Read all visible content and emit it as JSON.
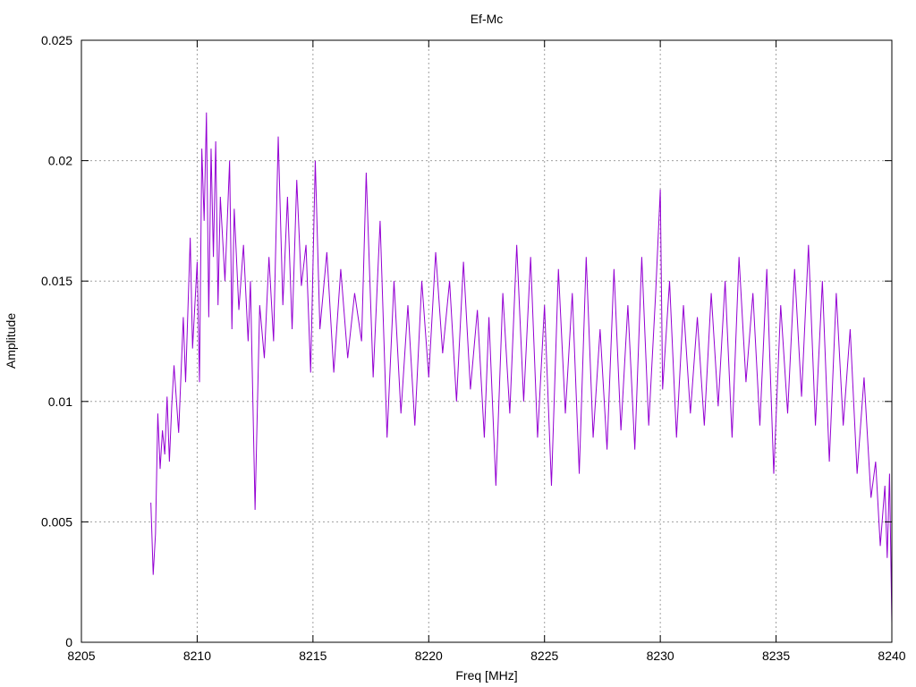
{
  "chart_data": {
    "type": "line",
    "title": "Ef-Mc",
    "xlabel": "Freq [MHz]",
    "ylabel": "Amplitude",
    "xlim": [
      8205,
      8240
    ],
    "ylim": [
      0,
      0.025
    ],
    "x_ticks": [
      8205,
      8210,
      8215,
      8220,
      8225,
      8230,
      8235,
      8240
    ],
    "x_tick_labels": [
      "8205",
      "8210",
      "8215",
      "8220",
      "8225",
      "8230",
      "8235",
      "8240"
    ],
    "y_ticks": [
      0,
      0.005,
      0.01,
      0.015,
      0.02,
      0.025
    ],
    "y_tick_labels": [
      "0",
      "0.005",
      "0.01",
      "0.015",
      "0.02",
      "0.025"
    ],
    "grid": true,
    "series": [
      {
        "color": "#9400d3",
        "x": [
          8208.0,
          8208.1,
          8208.2,
          8208.3,
          8208.4,
          8208.5,
          8208.6,
          8208.7,
          8208.8,
          8208.9,
          8209.0,
          8209.2,
          8209.4,
          8209.5,
          8209.7,
          8209.8,
          8210.0,
          8210.1,
          8210.2,
          8210.3,
          8210.4,
          8210.5,
          8210.6,
          8210.7,
          8210.8,
          8210.9,
          8211.0,
          8211.2,
          8211.4,
          8211.5,
          8211.6,
          8211.8,
          8212.0,
          8212.2,
          8212.3,
          8212.5,
          8212.7,
          8212.9,
          8213.1,
          8213.3,
          8213.5,
          8213.7,
          8213.9,
          8214.1,
          8214.3,
          8214.5,
          8214.7,
          8214.9,
          8215.1,
          8215.3,
          8215.6,
          8215.9,
          8216.2,
          8216.5,
          8216.8,
          8217.1,
          8217.3,
          8217.6,
          8217.9,
          8218.2,
          8218.5,
          8218.8,
          8219.1,
          8219.4,
          8219.7,
          8220.0,
          8220.3,
          8220.6,
          8220.9,
          8221.2,
          8221.5,
          8221.8,
          8222.1,
          8222.4,
          8222.6,
          8222.9,
          8223.2,
          8223.5,
          8223.8,
          8224.1,
          8224.4,
          8224.7,
          8225.0,
          8225.3,
          8225.6,
          8225.9,
          8226.2,
          8226.5,
          8226.8,
          8227.1,
          8227.4,
          8227.7,
          8228.0,
          8228.3,
          8228.6,
          8228.9,
          8229.2,
          8229.5,
          8229.8,
          8230.0,
          8230.1,
          8230.4,
          8230.7,
          8231.0,
          8231.3,
          8231.6,
          8231.9,
          8232.2,
          8232.5,
          8232.8,
          8233.1,
          8233.4,
          8233.7,
          8234.0,
          8234.3,
          8234.6,
          8234.9,
          8235.2,
          8235.5,
          8235.8,
          8236.1,
          8236.4,
          8236.7,
          8237.0,
          8237.3,
          8237.6,
          8237.9,
          8238.2,
          8238.5,
          8238.8,
          8239.1,
          8239.3,
          8239.5,
          8239.7,
          8239.8,
          8239.9,
          8240.0
        ],
        "y": [
          0.0058,
          0.0028,
          0.0045,
          0.0095,
          0.0072,
          0.0088,
          0.0078,
          0.0102,
          0.0075,
          0.0098,
          0.0115,
          0.0087,
          0.0135,
          0.0108,
          0.0168,
          0.0122,
          0.0158,
          0.0108,
          0.0205,
          0.0175,
          0.022,
          0.0135,
          0.0205,
          0.016,
          0.0208,
          0.014,
          0.0185,
          0.015,
          0.02,
          0.013,
          0.018,
          0.0138,
          0.0165,
          0.0125,
          0.015,
          0.0055,
          0.014,
          0.0118,
          0.016,
          0.0125,
          0.021,
          0.014,
          0.0185,
          0.013,
          0.0192,
          0.0148,
          0.0165,
          0.0112,
          0.02,
          0.013,
          0.0162,
          0.0112,
          0.0155,
          0.0118,
          0.0145,
          0.0125,
          0.0195,
          0.011,
          0.0175,
          0.0085,
          0.015,
          0.0095,
          0.014,
          0.009,
          0.015,
          0.011,
          0.0162,
          0.012,
          0.015,
          0.01,
          0.0158,
          0.0105,
          0.0138,
          0.0085,
          0.0135,
          0.0065,
          0.0145,
          0.0095,
          0.0165,
          0.01,
          0.016,
          0.0085,
          0.014,
          0.0065,
          0.0155,
          0.0095,
          0.0145,
          0.007,
          0.016,
          0.0085,
          0.013,
          0.008,
          0.0155,
          0.0088,
          0.014,
          0.008,
          0.016,
          0.009,
          0.0145,
          0.0188,
          0.0105,
          0.015,
          0.0085,
          0.014,
          0.0095,
          0.0135,
          0.009,
          0.0145,
          0.0098,
          0.015,
          0.0085,
          0.016,
          0.0108,
          0.0145,
          0.009,
          0.0155,
          0.007,
          0.014,
          0.0095,
          0.0155,
          0.0102,
          0.0165,
          0.009,
          0.015,
          0.0075,
          0.0145,
          0.009,
          0.013,
          0.007,
          0.011,
          0.006,
          0.0075,
          0.004,
          0.0065,
          0.0035,
          0.007,
          0.0008
        ]
      }
    ]
  }
}
